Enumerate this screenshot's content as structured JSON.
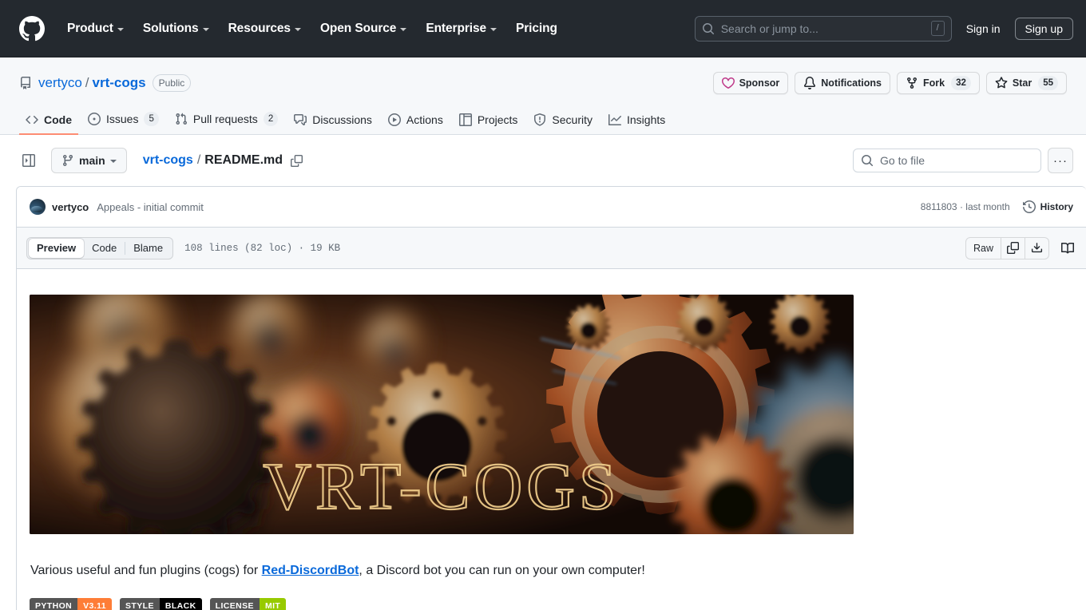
{
  "global_header": {
    "logo_icon": "github-mark-icon",
    "nav": [
      {
        "label": "Product",
        "has_caret": true
      },
      {
        "label": "Solutions",
        "has_caret": true
      },
      {
        "label": "Resources",
        "has_caret": true
      },
      {
        "label": "Open Source",
        "has_caret": true
      },
      {
        "label": "Enterprise",
        "has_caret": true
      },
      {
        "label": "Pricing",
        "has_caret": false
      }
    ],
    "search": {
      "placeholder": "Search or jump to...",
      "icon": "search-icon",
      "shortcut": "/"
    },
    "sign_in": "Sign in",
    "sign_up": "Sign up",
    "background": "#24292f"
  },
  "repo": {
    "icon": "repo-book-icon",
    "owner": "vertyco",
    "separator": "/",
    "name": "vrt-cogs",
    "visibility": "Public",
    "actions": [
      {
        "label": "Sponsor",
        "icon": "heart-icon",
        "count": null
      },
      {
        "label": "Notifications",
        "icon": "bell-icon",
        "count": null
      },
      {
        "label": "Fork",
        "icon": "fork-icon",
        "count": "32"
      },
      {
        "label": "Star",
        "icon": "star-icon",
        "count": "55"
      }
    ],
    "tabs": [
      {
        "label": "Code",
        "icon": "code-icon",
        "count": null,
        "active": true
      },
      {
        "label": "Issues",
        "icon": "issue-opened-icon",
        "count": "5",
        "active": false
      },
      {
        "label": "Pull requests",
        "icon": "git-pull-request-icon",
        "count": "2",
        "active": false
      },
      {
        "label": "Discussions",
        "icon": "comment-discussion-icon",
        "count": null,
        "active": false
      },
      {
        "label": "Actions",
        "icon": "play-icon",
        "count": null,
        "active": false
      },
      {
        "label": "Projects",
        "icon": "project-table-icon",
        "count": null,
        "active": false
      },
      {
        "label": "Security",
        "icon": "shield-icon",
        "count": null,
        "active": false
      },
      {
        "label": "Insights",
        "icon": "graph-icon",
        "count": null,
        "active": false
      }
    ],
    "active_tab_underline_color": "#fd8c73"
  },
  "file_nav": {
    "sidebar_toggle_icon": "sidebar-expand-icon",
    "branch": "main",
    "branch_icon": "git-branch-icon",
    "breadcrumb_repo": "vrt-cogs",
    "breadcrumb_sep": "/",
    "breadcrumb_file": "README.md",
    "copy_path_icon": "copy-icon",
    "go_to_file": {
      "placeholder": "Go to file",
      "icon": "search-icon"
    },
    "more_options": "···"
  },
  "commit": {
    "avatar": "user-avatar",
    "author": "vertyco",
    "message": "Appeals - initial commit",
    "hash": "8811803",
    "hash_separator": "·",
    "relative_time": "last month",
    "history_label": "History",
    "history_icon": "history-clock-icon"
  },
  "file_toolbar": {
    "views": [
      {
        "label": "Preview",
        "active": true
      },
      {
        "label": "Code",
        "active": false
      },
      {
        "label": "Blame",
        "active": false
      }
    ],
    "meta": "108 lines (82 loc) · 19 KB",
    "raw_label": "Raw",
    "copy_icon": "copy-raw-icon",
    "download_icon": "download-icon",
    "toc_icon": "table-of-contents-icon"
  },
  "readme": {
    "banner": {
      "alt": "VRT-COGS steampunk gears banner",
      "overlay_text": "VRT-COGS",
      "overlay_color": "#f0c070"
    },
    "paragraph": {
      "before": "Various useful and fun plugins (cogs) for ",
      "link": "Red-DiscordBot",
      "after": ", a Discord bot you can run on your own computer!"
    },
    "badges": [
      {
        "left": "PYTHON",
        "right": "V3.11",
        "right_color": "#fe7d37",
        "left_color": "#555555"
      },
      {
        "left": "STYLE",
        "right": "BLACK",
        "right_color": "#000000",
        "left_color": "#555555"
      },
      {
        "left": "LICENSE",
        "right": "MIT",
        "right_color": "#97ca00",
        "left_color": "#555555"
      }
    ]
  }
}
